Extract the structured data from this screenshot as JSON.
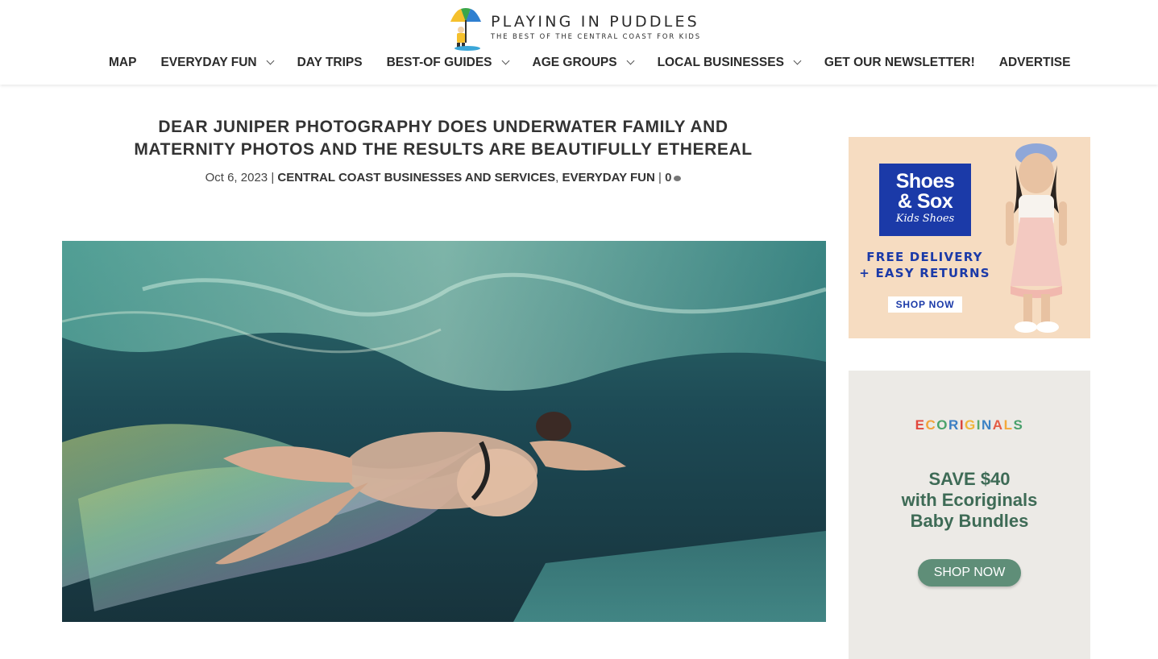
{
  "site": {
    "title": "PLAYING IN PUDDLES",
    "tagline": "THE BEST OF THE CENTRAL COAST FOR KIDS"
  },
  "nav": {
    "items": [
      {
        "label": "MAP",
        "dropdown": false
      },
      {
        "label": "EVERYDAY FUN",
        "dropdown": true
      },
      {
        "label": "DAY TRIPS",
        "dropdown": false
      },
      {
        "label": "BEST-OF GUIDES",
        "dropdown": true
      },
      {
        "label": "AGE GROUPS",
        "dropdown": true
      },
      {
        "label": "LOCAL BUSINESSES",
        "dropdown": true
      },
      {
        "label": "GET OUR NEWSLETTER!",
        "dropdown": false
      },
      {
        "label": "ADVERTISE",
        "dropdown": false
      }
    ]
  },
  "post": {
    "title": "DEAR JUNIPER PHOTOGRAPHY DOES UNDERWATER FAMILY AND MATERNITY PHOTOS AND THE RESULTS ARE BEAUTIFULLY ETHEREAL",
    "date": "Oct 6, 2023",
    "separator": "|",
    "category_1": "CENTRAL COAST BUSINESSES AND SERVICES",
    "category_sep": ",",
    "category_2": "EVERYDAY FUN",
    "comment_count": "0"
  },
  "ads": {
    "shoes_sox": {
      "brand_line1": "Shoes",
      "brand_line2": "& Sox",
      "brand_line3": "Kids Shoes",
      "line1": "FREE DELIVERY",
      "line2": "+ EASY RETURNS",
      "cta": "SHOP NOW"
    },
    "ecoriginals": {
      "brand_letters": [
        "E",
        "C",
        "O",
        "R",
        "I",
        "G",
        "I",
        "N",
        "A",
        "L",
        "S"
      ],
      "brand_colors": [
        "#e2483d",
        "#f2a23a",
        "#4aa36b",
        "#3b7fc4",
        "#d9453d",
        "#f0b43a",
        "#57a86b",
        "#3c82c5",
        "#e45c46",
        "#f3a93b",
        "#49a06c"
      ],
      "line1": "SAVE $40",
      "line2": "with Ecoriginals",
      "line3": "Baby Bundles",
      "cta": "SHOP NOW"
    }
  },
  "colors": {
    "nav_text": "#2b2b2b",
    "shoes_sox_blue": "#1b3aa8",
    "ecoriginals_green": "#3e6b56"
  }
}
